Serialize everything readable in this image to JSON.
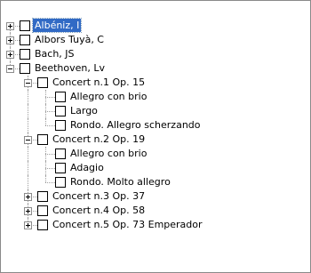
{
  "tree": {
    "items": [
      {
        "label": "Albéniz, I",
        "level": 0,
        "expander": "plus",
        "selected": true,
        "checked": false
      },
      {
        "label": "Albors Tuyà, C",
        "level": 0,
        "expander": "plus",
        "selected": false,
        "checked": false
      },
      {
        "label": "Bach, JS",
        "level": 0,
        "expander": "plus",
        "selected": false,
        "checked": false
      },
      {
        "label": "Beethoven, Lv",
        "level": 0,
        "expander": "minus",
        "selected": false,
        "checked": false
      },
      {
        "label": "Concert n.1 Op. 15",
        "level": 1,
        "expander": "minus",
        "selected": false,
        "checked": false
      },
      {
        "label": "Allegro con brio",
        "level": 2,
        "expander": "none",
        "selected": false,
        "checked": false
      },
      {
        "label": "Largo",
        "level": 2,
        "expander": "none",
        "selected": false,
        "checked": false
      },
      {
        "label": "Rondo. Allegro scherzando",
        "level": 2,
        "expander": "none",
        "selected": false,
        "checked": false
      },
      {
        "label": "Concert n.2 Op. 19",
        "level": 1,
        "expander": "minus",
        "selected": false,
        "checked": false
      },
      {
        "label": "Allegro con brio",
        "level": 2,
        "expander": "none",
        "selected": false,
        "checked": false
      },
      {
        "label": "Adagio",
        "level": 2,
        "expander": "none",
        "selected": false,
        "checked": false
      },
      {
        "label": "Rondo. Molto allegro",
        "level": 2,
        "expander": "none",
        "selected": false,
        "checked": false
      },
      {
        "label": "Concert n.3 Op. 37",
        "level": 1,
        "expander": "plus",
        "selected": false,
        "checked": false
      },
      {
        "label": "Concert n.4 Op. 58",
        "level": 1,
        "expander": "plus",
        "selected": false,
        "checked": false
      },
      {
        "label": "Concert n.5 Op. 73   Emperador",
        "level": 1,
        "expander": "plus",
        "selected": false,
        "checked": false
      }
    ]
  },
  "colors": {
    "panel_background": "#ffffff",
    "window_background": "#ece9d8",
    "selection_background": "#316ac5",
    "selection_text": "#ffffff",
    "tree_line": "#a0a0a0"
  }
}
